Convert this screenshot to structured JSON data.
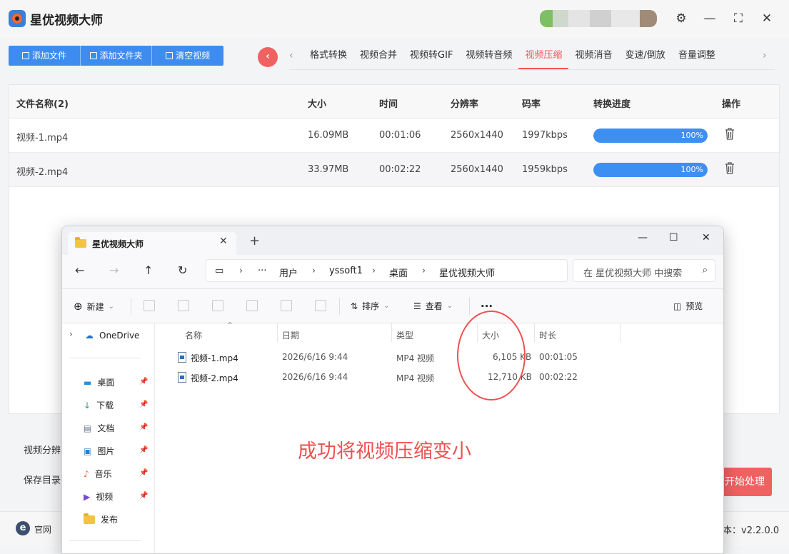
{
  "app": {
    "title": "星优视频大师",
    "toolbar": {
      "add_file": "添加文件",
      "add_folder": "添加文件夹",
      "clear": "清空视频"
    },
    "nav_back_icon": "chevron-left-icon",
    "tabs": [
      {
        "label": "格式转换"
      },
      {
        "label": "视频合并"
      },
      {
        "label": "视频转GIF"
      },
      {
        "label": "视频转音频"
      },
      {
        "label": "视频压缩",
        "active": true
      },
      {
        "label": "视频消音"
      },
      {
        "label": "变速/倒放"
      },
      {
        "label": "音量调整"
      }
    ],
    "table": {
      "headers": {
        "name": "文件名称(2)",
        "size": "大小",
        "time": "时间",
        "resolution": "分辨率",
        "bitrate": "码率",
        "progress": "转换进度",
        "action": "操作"
      },
      "rows": [
        {
          "name": "视频-1.mp4",
          "size": "16.09MB",
          "time": "00:01:06",
          "resolution": "2560x1440",
          "bitrate": "1997kbps",
          "progress": 1.0,
          "progress_text": "100%"
        },
        {
          "name": "视频-2.mp4",
          "size": "33.97MB",
          "time": "00:02:22",
          "resolution": "2560x1440",
          "bitrate": "1959kbps",
          "progress": 1.0,
          "progress_text": "100%"
        }
      ]
    },
    "bottom": {
      "resolution_label": "视频分辨",
      "output_label": "保存目录",
      "start_button": "开始处理"
    },
    "status": {
      "site_label": "官网",
      "version": "本：v2.2.0.0"
    },
    "colors": {
      "accent_blue": "#3e8cf0",
      "accent_red": "#f06161"
    }
  },
  "explorer": {
    "tab_title": "星优视频大师",
    "breadcrumb": [
      "用户",
      "yssoft1",
      "桌面",
      "星优视频大师"
    ],
    "search_placeholder": "在 星优视频大师 中搜索",
    "toolbar": {
      "new": "新建",
      "sort": "排序",
      "view": "查看",
      "more": "...",
      "preview": "预览"
    },
    "sidebar": {
      "onedrive": "OneDrive",
      "items": [
        {
          "label": "桌面",
          "icon": "desktop-icon"
        },
        {
          "label": "下载",
          "icon": "download-icon"
        },
        {
          "label": "文档",
          "icon": "document-icon"
        },
        {
          "label": "图片",
          "icon": "picture-icon"
        },
        {
          "label": "音乐",
          "icon": "music-icon"
        },
        {
          "label": "视频",
          "icon": "video-icon"
        },
        {
          "label": "发布",
          "icon": "folder-icon"
        }
      ]
    },
    "columns": {
      "name": "名称",
      "date": "日期",
      "type": "类型",
      "size": "大小",
      "duration": "时长"
    },
    "files": [
      {
        "name": "视频-1.mp4",
        "date": "2026/6/16 9:44",
        "type": "MP4 视频",
        "size": "6,105 KB",
        "duration": "00:01:05"
      },
      {
        "name": "视频-2.mp4",
        "date": "2026/6/16 9:44",
        "type": "MP4 视频",
        "size": "12,710 KB",
        "duration": "00:02:22"
      }
    ],
    "annotation": "成功将视频压缩变小"
  }
}
